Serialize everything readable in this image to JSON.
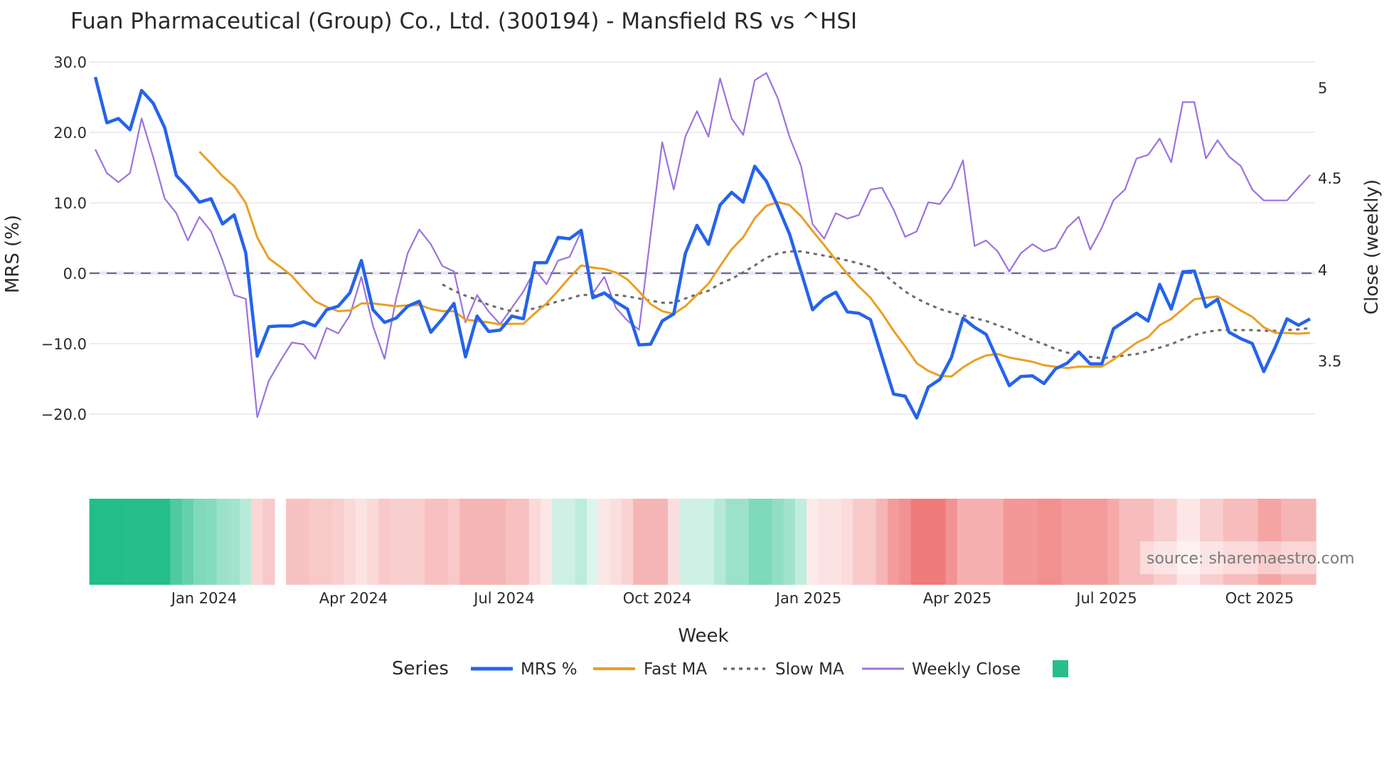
{
  "chart_data": {
    "type": "line",
    "title": "Fuan Pharmaceutical (Group) Co., Ltd. (300194) - Mansfield RS vs ^HSI",
    "xlabel": "Week",
    "ylabel": "MRS (%)",
    "y2label": "Close (weekly)",
    "ylim": [
      -22,
      31
    ],
    "y2lim": [
      3.15,
      5.2
    ],
    "yticks": [
      "30.0",
      "20.0",
      "10.0",
      "0.0",
      "−10.0",
      "−20.0"
    ],
    "y2ticks": [
      "5",
      "4.5",
      "4",
      "3.5"
    ],
    "xticks": [
      "Jan 2024",
      "Apr 2024",
      "Jul 2024",
      "Oct 2024",
      "Jan 2025",
      "Apr 2025",
      "Jul 2025",
      "Oct 2025"
    ],
    "grid": true,
    "zero_line": 0,
    "legend_title": "Series",
    "legend_position": "bottom",
    "series": [
      {
        "name": "MRS %",
        "color": "#2563EB",
        "axis": "left",
        "style": "solid",
        "values": [
          27.9,
          21.4,
          22.0,
          20.4,
          26.0,
          24.2,
          20.7,
          13.9,
          12.2,
          10.1,
          10.6,
          7.0,
          8.3,
          2.9,
          -11.8,
          -7.6,
          -7.5,
          -7.5,
          -6.9,
          -7.5,
          -5.2,
          -4.7,
          -2.8,
          1.8,
          -5.2,
          -7.0,
          -6.4,
          -4.7,
          -4.0,
          -8.4,
          -6.5,
          -4.3,
          -11.9,
          -6.1,
          -8.3,
          -8.1,
          -6.1,
          -6.5,
          1.5,
          1.5,
          5.1,
          4.9,
          6.1,
          -3.5,
          -2.8,
          -4.1,
          -5.1,
          -10.2,
          -10.1,
          -6.8,
          -5.8,
          2.8,
          6.8,
          4.1,
          9.7,
          11.5,
          10.1,
          15.2,
          13.1,
          9.5,
          5.6,
          0.2,
          -5.2,
          -3.6,
          -2.7,
          -5.5,
          -5.7,
          -6.6,
          -11.9,
          -17.2,
          -17.5,
          -20.6,
          -16.2,
          -15.1,
          -12.0,
          -6.4,
          -7.7,
          -8.7,
          -12.4,
          -16.0,
          -14.7,
          -14.6,
          -15.7,
          -13.6,
          -12.8,
          -11.2,
          -12.9,
          -12.9,
          -7.9,
          -6.8,
          -5.7,
          -6.8,
          -1.6,
          -5.1,
          0.2,
          0.3,
          -4.8,
          -3.7,
          -8.4,
          -9.3,
          -10.0,
          -14.0,
          -10.5,
          -6.5,
          -7.4,
          -6.5
        ]
      },
      {
        "name": "Fast MA",
        "color": "#E9A023",
        "axis": "left",
        "style": "solid",
        "values": [
          null,
          null,
          null,
          null,
          null,
          null,
          null,
          null,
          null,
          17.3,
          15.6,
          13.8,
          12.4,
          10.0,
          5.1,
          2.1,
          0.9,
          -0.4,
          -2.3,
          -4.0,
          -4.8,
          -5.4,
          -5.3,
          -4.3,
          -4.3,
          -4.5,
          -4.7,
          -4.6,
          -4.5,
          -5.1,
          -5.4,
          -5.4,
          -6.6,
          -6.8,
          -7.0,
          -7.3,
          -7.2,
          -7.2,
          -5.7,
          -4.3,
          -2.5,
          -0.6,
          1.1,
          0.8,
          0.6,
          0.1,
          -0.9,
          -2.6,
          -4.4,
          -5.4,
          -5.8,
          -4.7,
          -3.1,
          -1.5,
          1.0,
          3.4,
          5.1,
          7.8,
          9.6,
          10.1,
          9.7,
          8.1,
          6.0,
          4.0,
          1.9,
          -0.1,
          -1.9,
          -3.5,
          -5.7,
          -8.2,
          -10.4,
          -12.8,
          -13.9,
          -14.6,
          -14.7,
          -13.4,
          -12.4,
          -11.7,
          -11.5,
          -12.0,
          -12.3,
          -12.6,
          -13.1,
          -13.3,
          -13.5,
          -13.3,
          -13.3,
          -13.3,
          -12.3,
          -11.1,
          -9.9,
          -9.1,
          -7.4,
          -6.5,
          -5.1,
          -3.7,
          -3.5,
          -3.3,
          -4.3,
          -5.3,
          -6.2,
          -7.7,
          -8.5,
          -8.5,
          -8.6,
          -8.5
        ]
      },
      {
        "name": "Slow MA",
        "color": "#6B6B6B",
        "axis": "left",
        "style": "dotted",
        "values": [
          null,
          null,
          null,
          null,
          null,
          null,
          null,
          null,
          null,
          null,
          null,
          null,
          null,
          null,
          null,
          null,
          null,
          null,
          null,
          null,
          null,
          null,
          null,
          null,
          null,
          null,
          null,
          null,
          null,
          null,
          -1.6,
          -2.5,
          -3.2,
          -3.8,
          -4.5,
          -5.0,
          -5.4,
          -5.3,
          -5.0,
          -4.5,
          -4.0,
          -3.6,
          -3.1,
          -3.1,
          -3.1,
          -3.1,
          -3.3,
          -3.6,
          -3.9,
          -4.2,
          -4.2,
          -3.6,
          -3.0,
          -2.5,
          -1.5,
          -0.8,
          0.1,
          1.1,
          2.2,
          2.8,
          3.1,
          3.1,
          2.8,
          2.5,
          2.2,
          1.8,
          1.4,
          0.9,
          0.1,
          -1.3,
          -2.6,
          -3.6,
          -4.4,
          -5.1,
          -5.6,
          -6.0,
          -6.4,
          -6.8,
          -7.4,
          -8.0,
          -8.8,
          -9.5,
          -10.1,
          -10.8,
          -11.3,
          -11.7,
          -11.9,
          -12.1,
          -11.9,
          -11.7,
          -11.5,
          -11.1,
          -10.6,
          -10.1,
          -9.4,
          -8.8,
          -8.4,
          -8.1,
          -8.1,
          -8.1,
          -8.1,
          -8.2,
          -8.2,
          -8.1,
          -8.0,
          -7.8
        ]
      },
      {
        "name": "Weekly Close",
        "color": "#9B72E0",
        "axis": "right",
        "style": "solid",
        "values": [
          4.66,
          4.53,
          4.48,
          4.53,
          4.83,
          4.62,
          4.39,
          4.31,
          4.16,
          4.29,
          4.21,
          4.05,
          3.86,
          3.84,
          3.19,
          3.39,
          3.5,
          3.6,
          3.59,
          3.51,
          3.68,
          3.65,
          3.75,
          3.96,
          3.69,
          3.51,
          3.84,
          4.09,
          4.22,
          4.14,
          4.02,
          3.99,
          3.71,
          3.86,
          3.77,
          3.7,
          3.79,
          3.88,
          4.0,
          3.92,
          4.05,
          4.07,
          4.21,
          3.87,
          3.96,
          3.79,
          3.72,
          3.67,
          4.19,
          4.7,
          4.44,
          4.73,
          4.87,
          4.73,
          5.05,
          4.83,
          4.74,
          5.04,
          5.08,
          4.94,
          4.73,
          4.57,
          4.25,
          4.17,
          4.31,
          4.28,
          4.3,
          4.44,
          4.45,
          4.33,
          4.18,
          4.21,
          4.37,
          4.36,
          4.45,
          4.6,
          4.13,
          4.16,
          4.1,
          3.99,
          4.09,
          4.14,
          4.1,
          4.12,
          4.23,
          4.29,
          4.11,
          4.23,
          4.38,
          4.44,
          4.61,
          4.63,
          4.72,
          4.59,
          4.92,
          4.92,
          4.61,
          4.71,
          4.62,
          4.57,
          4.44,
          4.38,
          4.38,
          4.38,
          4.45,
          4.52
        ]
      }
    ],
    "heatmap": {
      "positive_color": "#22BD89",
      "negative_color": "#EC5A5A",
      "values": [
        1,
        1,
        1,
        0.98,
        0.98,
        0.98,
        0.98,
        0.8,
        0.7,
        0.57,
        0.55,
        0.45,
        0.42,
        0.32,
        -0.25,
        -0.33,
        null,
        -0.37,
        -0.37,
        -0.33,
        -0.33,
        -0.3,
        -0.23,
        -0.17,
        -0.23,
        -0.33,
        -0.3,
        -0.3,
        -0.3,
        -0.38,
        -0.38,
        -0.33,
        -0.45,
        -0.45,
        -0.45,
        -0.45,
        -0.38,
        -0.38,
        -0.23,
        -0.15,
        0.22,
        0.22,
        0.3,
        0.15,
        -0.15,
        -0.2,
        -0.27,
        -0.45,
        -0.45,
        -0.45,
        -0.2,
        0.22,
        0.22,
        0.22,
        0.33,
        0.45,
        0.45,
        0.58,
        0.58,
        0.5,
        0.42,
        0.28,
        -0.12,
        -0.17,
        -0.17,
        -0.22,
        -0.32,
        -0.32,
        -0.45,
        -0.6,
        -0.66,
        -0.8,
        -0.8,
        -0.8,
        -0.66,
        -0.48,
        -0.48,
        -0.48,
        -0.48,
        -0.63,
        -0.63,
        -0.63,
        -0.68,
        -0.68,
        -0.6,
        -0.6,
        -0.6,
        -0.6,
        -0.52,
        -0.4,
        -0.4,
        -0.4,
        -0.3,
        -0.3,
        -0.15,
        -0.15,
        -0.3,
        -0.3,
        -0.4,
        -0.4,
        -0.4,
        -0.55,
        -0.55,
        -0.45,
        -0.45,
        -0.45
      ]
    },
    "annotation": "source: sharemaestro.com"
  }
}
